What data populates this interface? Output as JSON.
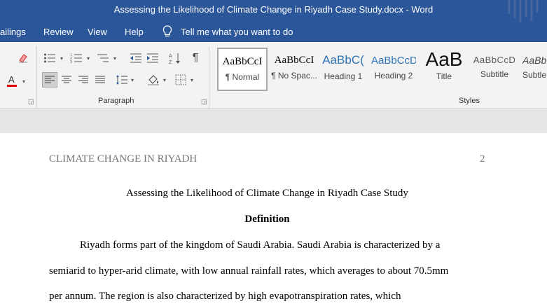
{
  "window": {
    "title": "Assessing the Likelihood of Climate Change in Riyadh Case Study.docx  -  Word"
  },
  "menu": {
    "mailings": "ailings",
    "review": "Review",
    "view": "View",
    "help": "Help",
    "tell_me": "Tell me what you want to do"
  },
  "ribbon": {
    "paragraph_group": "Paragraph",
    "styles_group": "Styles",
    "styles": [
      {
        "sample": "AaBbCcI",
        "name": "¶ Normal"
      },
      {
        "sample": "AaBbCcI",
        "name": "¶ No Spac..."
      },
      {
        "sample": "AaBbC(",
        "name": "Heading 1"
      },
      {
        "sample": "AaBbCcD",
        "name": "Heading 2"
      },
      {
        "sample": "AaB",
        "name": "Title"
      },
      {
        "sample": "AaBbCcD",
        "name": "Subtitle"
      },
      {
        "sample": "AaBbI",
        "name": "Subtle"
      }
    ]
  },
  "document": {
    "header": "CLIMATE CHANGE IN RIYADH",
    "page_number": "2",
    "title": "Assessing the Likelihood of Climate Change in Riyadh Case Study",
    "heading": "Definition",
    "lines": [
      "Riyadh forms part of the kingdom of Saudi Arabia. Saudi Arabia is characterized by a",
      "semiarid to hyper-arid climate, with low annual rainfall rates, which averages to about 70.5mm",
      "per annum. The region is also characterized by high evapotranspiration rates, which"
    ]
  },
  "colors": {
    "title_bar": "#2b579a",
    "heading_blue": "#2e74b5",
    "font_color_red": "#e00000"
  }
}
